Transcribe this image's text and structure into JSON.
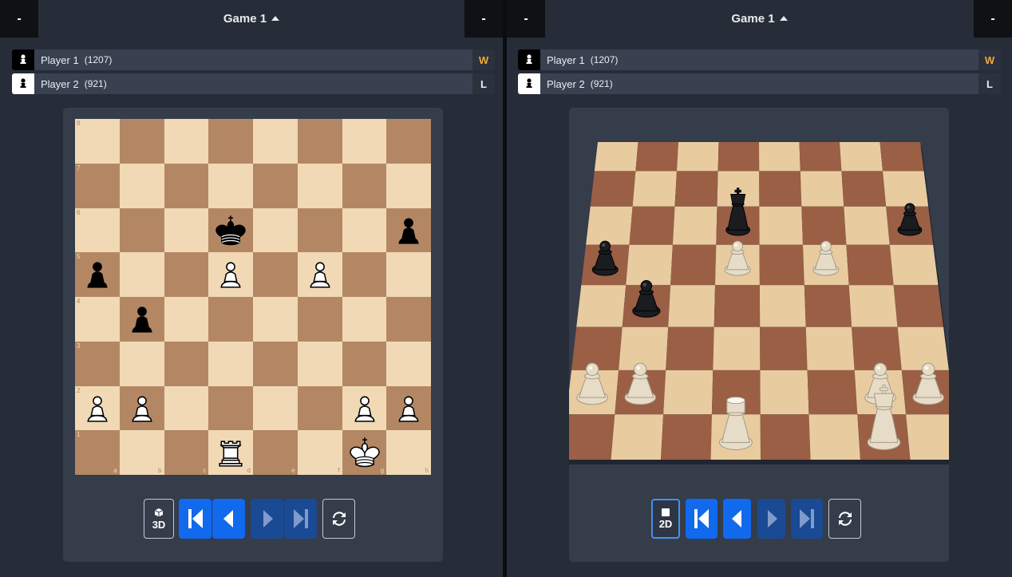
{
  "left": {
    "header": {
      "left_btn": "-",
      "title": "Game 1",
      "right_btn": "-"
    },
    "players": [
      {
        "name": "Player 1",
        "rating": "(1207)",
        "result": "W"
      },
      {
        "name": "Player 2",
        "rating": "(921)",
        "result": "L"
      }
    ],
    "controls": {
      "view_toggle": "3D"
    },
    "files": [
      "a",
      "b",
      "c",
      "d",
      "e",
      "f",
      "g",
      "h"
    ],
    "ranks": [
      "8",
      "7",
      "6",
      "5",
      "4",
      "3",
      "2",
      "1"
    ]
  },
  "right": {
    "header": {
      "left_btn": "-",
      "title": "Game 1",
      "right_btn": "-"
    },
    "players": [
      {
        "name": "Player 1",
        "rating": "(1207)",
        "result": "W"
      },
      {
        "name": "Player 2",
        "rating": "(921)",
        "result": "L"
      }
    ],
    "controls": {
      "view_toggle": "2D"
    }
  },
  "position": [
    {
      "square": "d6",
      "piece": "king",
      "color": "black"
    },
    {
      "square": "h6",
      "piece": "pawn",
      "color": "black"
    },
    {
      "square": "a5",
      "piece": "pawn",
      "color": "black"
    },
    {
      "square": "b4",
      "piece": "pawn",
      "color": "black"
    },
    {
      "square": "d5",
      "piece": "pawn",
      "color": "white"
    },
    {
      "square": "f5",
      "piece": "pawn",
      "color": "white"
    },
    {
      "square": "a2",
      "piece": "pawn",
      "color": "white"
    },
    {
      "square": "b2",
      "piece": "pawn",
      "color": "white"
    },
    {
      "square": "g2",
      "piece": "pawn",
      "color": "white"
    },
    {
      "square": "h2",
      "piece": "pawn",
      "color": "white"
    },
    {
      "square": "d1",
      "piece": "rook",
      "color": "white"
    },
    {
      "square": "g1",
      "piece": "king",
      "color": "white"
    }
  ],
  "colors": {
    "light_square": "#f1d9b5",
    "dark_square": "#b48764",
    "button_blue": "#1169ee",
    "button_disabled": "#1a4a93",
    "win_color": "#f0a938"
  },
  "icons": {
    "first": "skip-to-start-icon",
    "prev": "step-back-icon",
    "next": "step-forward-icon",
    "last": "skip-to-end-icon",
    "flip": "flip-board-icon",
    "view3d": "cube-icon"
  }
}
